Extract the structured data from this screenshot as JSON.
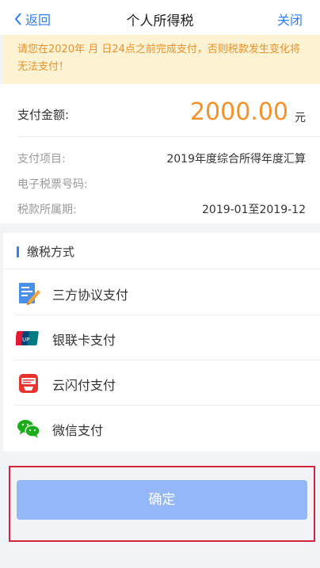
{
  "nav": {
    "back_label": "返回",
    "title": "个人所得税",
    "close_label": "关闭"
  },
  "notice": {
    "text": "请您在2020年  月  日24点之前完成支付，否则税款发生变化将无法支付！"
  },
  "payment": {
    "amount_label": "支付金额:",
    "amount_value": "2000.00",
    "amount_unit": "元",
    "rows": [
      {
        "key": "支付项目:",
        "value": "2019年度综合所得年度汇算"
      },
      {
        "key": "电子税票号码:",
        "value": ""
      },
      {
        "key": "税款所属期:",
        "value": "2019-01至2019-12"
      }
    ]
  },
  "methods": {
    "heading": "缴税方式",
    "items": [
      {
        "label": "三方协议支付",
        "icon": "agreement-icon"
      },
      {
        "label": "银联卡支付",
        "icon": "unionpay-icon"
      },
      {
        "label": "云闪付支付",
        "icon": "quickpass-icon"
      },
      {
        "label": "微信支付",
        "icon": "wechat-icon"
      }
    ]
  },
  "confirm_label": "确定",
  "colors": {
    "accent": "#2f7ef2",
    "amount": "#f5902b",
    "notice_bg": "#fdf3d3",
    "notice_text": "#e8902a",
    "button": "#93b7f7",
    "highlight": "#d3263a"
  }
}
